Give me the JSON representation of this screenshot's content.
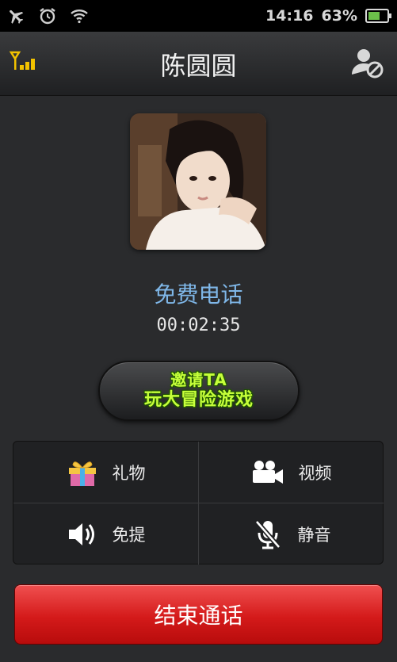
{
  "status_bar": {
    "icons": [
      "airplane-mode-icon",
      "alarm-icon",
      "wifi-icon"
    ],
    "time": "14:16",
    "battery_percent": "63%",
    "battery_level": 0.63,
    "battery_icon": "battery-charging-icon"
  },
  "header": {
    "title": "陈圆圆",
    "left_icon": "signal-icon",
    "right_icon": "block-contact-icon"
  },
  "call": {
    "avatar_icon": "contact-avatar",
    "type": "免费电话",
    "duration": "00:02:35"
  },
  "invite": {
    "line1": "邀请TA",
    "line2": "玩大冒险游戏"
  },
  "actions": [
    {
      "label": "礼物",
      "icon": "gift-icon"
    },
    {
      "label": "视频",
      "icon": "video-camera-icon"
    },
    {
      "label": "免提",
      "icon": "speaker-icon"
    },
    {
      "label": "静音",
      "icon": "mute-mic-icon"
    }
  ],
  "end_call": {
    "label": "结束通话"
  },
  "colors": {
    "accent_blue": "#7fb7e8",
    "end_call_red": "#d41a1a",
    "invite_green": "#c6ff3a",
    "signal_yellow": "#f2c200"
  }
}
